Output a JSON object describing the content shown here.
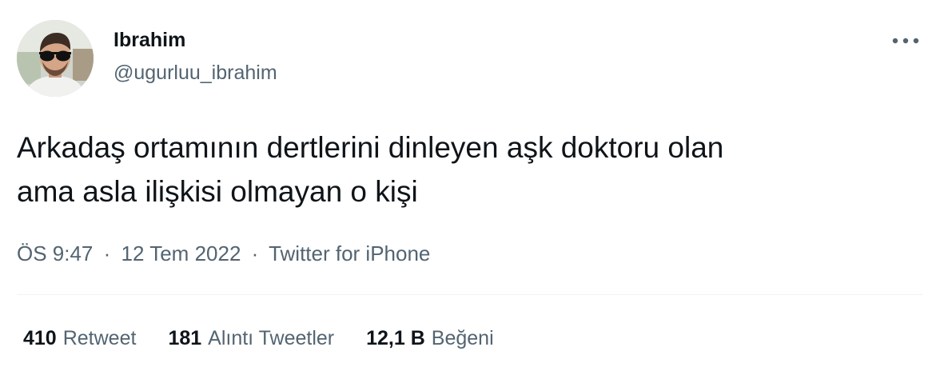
{
  "user": {
    "display_name": "Ibrahim",
    "handle": "@ugurluu_ibrahim",
    "avatar_icon": "user-avatar-photo"
  },
  "menu": {
    "more_icon": "more-horizontal-icon"
  },
  "tweet": {
    "text_line1": "Arkadaş ortamının dertlerini dinleyen aşk doktoru olan",
    "text_line2": "ama asla ilişkisi olmayan o kişi"
  },
  "meta": {
    "time": "ÖS 9:47",
    "separator": "·",
    "date": "12 Tem 2022",
    "source": "Twitter for iPhone"
  },
  "stats": {
    "retweets": {
      "count": "410",
      "label": "Retweet"
    },
    "quotes": {
      "count": "181",
      "label": "Alıntı Tweetler"
    },
    "likes": {
      "count": "12,1 B",
      "label": "Beğeni"
    }
  },
  "colors": {
    "primary_text": "#0f1419",
    "secondary_text": "#536471",
    "divider": "#eff3f4",
    "background": "#ffffff"
  }
}
